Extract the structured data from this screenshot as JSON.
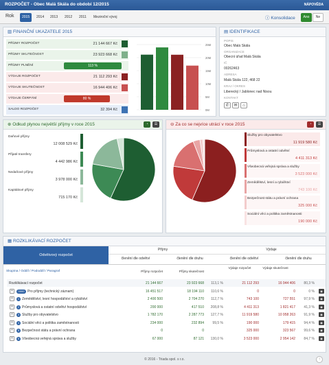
{
  "topbar": {
    "title": "ROZPOČET - Obec Malá Skála do období 12/2015",
    "help": "NÁPOVĚDA"
  },
  "tabs": {
    "label": "Rok",
    "years": [
      "2015",
      "2014",
      "2013",
      "2012",
      "2011"
    ],
    "multi": "Meziroční vývoj",
    "konsolidace": "Konsolidace",
    "ano": "Ano",
    "ne": "Ne"
  },
  "kpi": {
    "title": "FINANČNÍ UKAZATELE 2015",
    "rows": [
      {
        "label": "PŘÍJMY ROZPOČET",
        "value": "21 144 667 Kč",
        "color": "#1e5e32"
      },
      {
        "label": "PŘÍJMY SKUTEČNOST",
        "value": "23 923 668 Kč",
        "color": "#7fb08a"
      },
      {
        "label": "PŘÍJMY PLNĚNÍ",
        "value": "113 %",
        "color": "#2f8a3f"
      },
      {
        "label": "VÝDAJE ROZPOČET",
        "value": "21 112 293 Kč",
        "color": "#8b2222"
      },
      {
        "label": "VÝDAJE SKUTEČNOST",
        "value": "16 944 406 Kč",
        "color": "#c75050"
      },
      {
        "label": "VÝDAJE ČERPÁNÍ",
        "value": "80 %",
        "color": "#c0392b"
      },
      {
        "label": "SALDO ROZPOČET",
        "value": "32 394 Kč",
        "color": "#3e73b3"
      }
    ],
    "plneni_pct": 113,
    "cerpani_pct": 80,
    "axis": [
      "25M",
      "20M",
      "15M",
      "10M",
      "5M",
      "0M"
    ],
    "bars": [
      21.14,
      23.92,
      21.11,
      16.94
    ],
    "bar_colors": [
      "#1e5e32",
      "#2f8a3f",
      "#8b2222",
      "#c75050"
    ]
  },
  "ident": {
    "title": "IDENTIFIKACE",
    "popis_l": "POPIS",
    "popis": "Obec Malá Skála",
    "org_l": "ORGANIZACE",
    "org": "Obecní úřad Malá Skála",
    "ic_l": "IČ",
    "ic": "00262463",
    "adr_l": "ADRESA",
    "adr": "Malá Skála 122, 468 22",
    "kraj_l": "KRAJ / OKRES",
    "kraj": "Liberecký / Jablonec nad Nisou",
    "kont_l": "KONTAKT"
  },
  "income": {
    "title": "Odkud plynou největší příjmy v roce 2015",
    "items": [
      {
        "label": "Daňové příjmy",
        "value": "12 008 529 Kč",
        "color": "#1e5e32"
      },
      {
        "label": "Přijaté transfery",
        "value": "4 442 986 Kč",
        "color": "#3d8a55"
      },
      {
        "label": "Nedaňové příjmy",
        "value": "3 978 000 Kč",
        "color": "#8cb89a"
      },
      {
        "label": "Kapitálové příjmy",
        "value": "715 170 Kč",
        "color": "#d5e6d9"
      }
    ]
  },
  "spend": {
    "title": "Za co se nejvíce utrácí v roce 2015",
    "items": [
      {
        "label": "Služby pro obyvatelstvo",
        "value": "11 919 580 Kč",
        "color": "#8b1f1f"
      },
      {
        "label": "Průmyslová a ostatní odvětví",
        "value": "4 411 313 Kč",
        "color": "#c03a3a"
      },
      {
        "label": "Všeobecná veřejná správa a služby",
        "value": "3 523 000 Kč",
        "color": "#d97070"
      },
      {
        "label": "Zemědělství, lesní a rybářství",
        "value": "743 100 Kč",
        "color": "#e9a5a5"
      },
      {
        "label": "Bezpečnost státu a právní ochrana",
        "value": "325 000 Kč",
        "color": "#f3cccc"
      },
      {
        "label": "Sociální věci a politika zaměstnanosti",
        "value": "190 000 Kč",
        "color": "#f9e3e3"
      }
    ]
  },
  "table": {
    "title": "ROZKLIKÁVACÍ ROZPOČET",
    "tab": "Odvětvový rozpočet",
    "grp1": "Příjmy",
    "grp2": "Výdaje",
    "sub": [
      "členění dle odvětví",
      "členění dle druhu",
      "členění dle odvětví",
      "členění dle druhu"
    ],
    "crumb": "Skupina / Oddíl / Pododdíl / Paragraf",
    "cols": [
      "Příjmy rozpočet",
      "Příjmy skutečnost",
      "",
      "Výdaje rozpočet",
      "Výdaje skutečnost",
      ""
    ],
    "rows": [
      {
        "name": "Rozklikávací rozpočet",
        "n": "",
        "c": [
          "21 144 667",
          "23 923 668",
          "113,1 %",
          "21 112 293",
          "16 944 406",
          "80,3 %"
        ]
      },
      {
        "name": "Pro příjmy (technický záznam)",
        "n": "0000",
        "c": [
          "16 451 517",
          "18 194 110",
          "110,6 %",
          "0",
          "0",
          "0 %"
        ]
      },
      {
        "name": "Zemědělství, lesní hospodářství a rybářství",
        "n": "1",
        "c": [
          "2 400 500",
          "2 704 270",
          "112,7 %",
          "743 100",
          "727 551",
          "97,9 %"
        ]
      },
      {
        "name": "Průmyslová a ostatní odvětví hospodářství",
        "n": "2",
        "c": [
          "200 000",
          "417 510",
          "208,8 %",
          "4 411 313",
          "1 821 417",
          "41,3 %"
        ]
      },
      {
        "name": "Služby pro obyvatelstvo",
        "n": "3",
        "c": [
          "1 782 170",
          "2 287 773",
          "127,7 %",
          "11 919 580",
          "10 958 263",
          "91,9 %"
        ]
      },
      {
        "name": "Sociální věci a politika zaměstnanosti",
        "n": "4",
        "c": [
          "234 000",
          "232 894",
          "99,5 %",
          "190 000",
          "179 415",
          "94,4 %"
        ]
      },
      {
        "name": "Bezpečnost státu a právní ochrana",
        "n": "5",
        "c": [
          "0",
          "0",
          "",
          "325 000",
          "323 567",
          "99,6 %"
        ]
      },
      {
        "name": "Všeobecná veřejná správa a služby",
        "n": "6",
        "c": [
          "67 000",
          "87 121",
          "130,0 %",
          "3 523 000",
          "2 954 142",
          "84,7 %"
        ]
      }
    ]
  },
  "footer": "© 2016 - Triada spol. s r.o."
}
